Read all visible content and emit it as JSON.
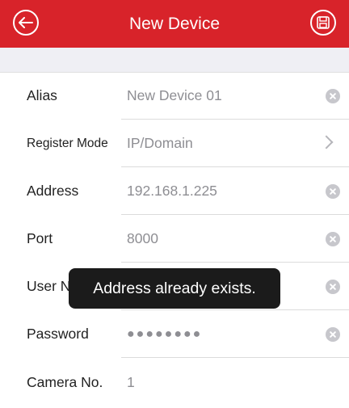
{
  "header": {
    "title": "New Device",
    "back_icon": "back-arrow-icon",
    "save_icon": "save-icon",
    "color": "#d8232a"
  },
  "form": {
    "fields": [
      {
        "label": "Alias",
        "value": "New Device 01",
        "action": "clear"
      },
      {
        "label": "Register Mode",
        "value": "IP/Domain",
        "action": "chevron"
      },
      {
        "label": "Address",
        "value": "192.168.1.225",
        "action": "clear"
      },
      {
        "label": "Port",
        "value": "8000",
        "action": "clear"
      },
      {
        "label": "User N",
        "value": "",
        "action": "clear"
      },
      {
        "label": "Password",
        "value": "●●●●●●●●",
        "action": "clear"
      },
      {
        "label": "Camera No.",
        "value": "1",
        "action": ""
      }
    ]
  },
  "toast": {
    "message": "Address already exists."
  }
}
